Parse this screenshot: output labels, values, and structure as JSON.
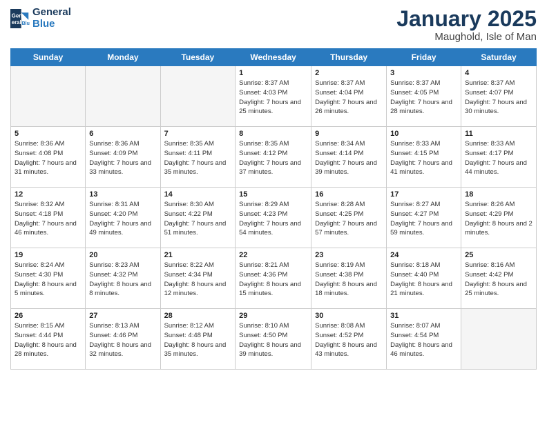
{
  "logo": {
    "line1": "General",
    "line2": "Blue"
  },
  "title": "January 2025",
  "subtitle": "Maughold, Isle of Man",
  "weekdays": [
    "Sunday",
    "Monday",
    "Tuesday",
    "Wednesday",
    "Thursday",
    "Friday",
    "Saturday"
  ],
  "weeks": [
    [
      {
        "day": "",
        "empty": true
      },
      {
        "day": "",
        "empty": true
      },
      {
        "day": "",
        "empty": true
      },
      {
        "day": "1",
        "sunrise": "8:37 AM",
        "sunset": "4:03 PM",
        "daylight": "7 hours and 25 minutes."
      },
      {
        "day": "2",
        "sunrise": "8:37 AM",
        "sunset": "4:04 PM",
        "daylight": "7 hours and 26 minutes."
      },
      {
        "day": "3",
        "sunrise": "8:37 AM",
        "sunset": "4:05 PM",
        "daylight": "7 hours and 28 minutes."
      },
      {
        "day": "4",
        "sunrise": "8:37 AM",
        "sunset": "4:07 PM",
        "daylight": "7 hours and 30 minutes."
      }
    ],
    [
      {
        "day": "5",
        "sunrise": "8:36 AM",
        "sunset": "4:08 PM",
        "daylight": "7 hours and 31 minutes."
      },
      {
        "day": "6",
        "sunrise": "8:36 AM",
        "sunset": "4:09 PM",
        "daylight": "7 hours and 33 minutes."
      },
      {
        "day": "7",
        "sunrise": "8:35 AM",
        "sunset": "4:11 PM",
        "daylight": "7 hours and 35 minutes."
      },
      {
        "day": "8",
        "sunrise": "8:35 AM",
        "sunset": "4:12 PM",
        "daylight": "7 hours and 37 minutes."
      },
      {
        "day": "9",
        "sunrise": "8:34 AM",
        "sunset": "4:14 PM",
        "daylight": "7 hours and 39 minutes."
      },
      {
        "day": "10",
        "sunrise": "8:33 AM",
        "sunset": "4:15 PM",
        "daylight": "7 hours and 41 minutes."
      },
      {
        "day": "11",
        "sunrise": "8:33 AM",
        "sunset": "4:17 PM",
        "daylight": "7 hours and 44 minutes."
      }
    ],
    [
      {
        "day": "12",
        "sunrise": "8:32 AM",
        "sunset": "4:18 PM",
        "daylight": "7 hours and 46 minutes."
      },
      {
        "day": "13",
        "sunrise": "8:31 AM",
        "sunset": "4:20 PM",
        "daylight": "7 hours and 49 minutes."
      },
      {
        "day": "14",
        "sunrise": "8:30 AM",
        "sunset": "4:22 PM",
        "daylight": "7 hours and 51 minutes."
      },
      {
        "day": "15",
        "sunrise": "8:29 AM",
        "sunset": "4:23 PM",
        "daylight": "7 hours and 54 minutes."
      },
      {
        "day": "16",
        "sunrise": "8:28 AM",
        "sunset": "4:25 PM",
        "daylight": "7 hours and 57 minutes."
      },
      {
        "day": "17",
        "sunrise": "8:27 AM",
        "sunset": "4:27 PM",
        "daylight": "7 hours and 59 minutes."
      },
      {
        "day": "18",
        "sunrise": "8:26 AM",
        "sunset": "4:29 PM",
        "daylight": "8 hours and 2 minutes."
      }
    ],
    [
      {
        "day": "19",
        "sunrise": "8:24 AM",
        "sunset": "4:30 PM",
        "daylight": "8 hours and 5 minutes."
      },
      {
        "day": "20",
        "sunrise": "8:23 AM",
        "sunset": "4:32 PM",
        "daylight": "8 hours and 8 minutes."
      },
      {
        "day": "21",
        "sunrise": "8:22 AM",
        "sunset": "4:34 PM",
        "daylight": "8 hours and 12 minutes."
      },
      {
        "day": "22",
        "sunrise": "8:21 AM",
        "sunset": "4:36 PM",
        "daylight": "8 hours and 15 minutes."
      },
      {
        "day": "23",
        "sunrise": "8:19 AM",
        "sunset": "4:38 PM",
        "daylight": "8 hours and 18 minutes."
      },
      {
        "day": "24",
        "sunrise": "8:18 AM",
        "sunset": "4:40 PM",
        "daylight": "8 hours and 21 minutes."
      },
      {
        "day": "25",
        "sunrise": "8:16 AM",
        "sunset": "4:42 PM",
        "daylight": "8 hours and 25 minutes."
      }
    ],
    [
      {
        "day": "26",
        "sunrise": "8:15 AM",
        "sunset": "4:44 PM",
        "daylight": "8 hours and 28 minutes."
      },
      {
        "day": "27",
        "sunrise": "8:13 AM",
        "sunset": "4:46 PM",
        "daylight": "8 hours and 32 minutes."
      },
      {
        "day": "28",
        "sunrise": "8:12 AM",
        "sunset": "4:48 PM",
        "daylight": "8 hours and 35 minutes."
      },
      {
        "day": "29",
        "sunrise": "8:10 AM",
        "sunset": "4:50 PM",
        "daylight": "8 hours and 39 minutes."
      },
      {
        "day": "30",
        "sunrise": "8:08 AM",
        "sunset": "4:52 PM",
        "daylight": "8 hours and 43 minutes."
      },
      {
        "day": "31",
        "sunrise": "8:07 AM",
        "sunset": "4:54 PM",
        "daylight": "8 hours and 46 minutes."
      },
      {
        "day": "",
        "empty": true
      }
    ]
  ]
}
